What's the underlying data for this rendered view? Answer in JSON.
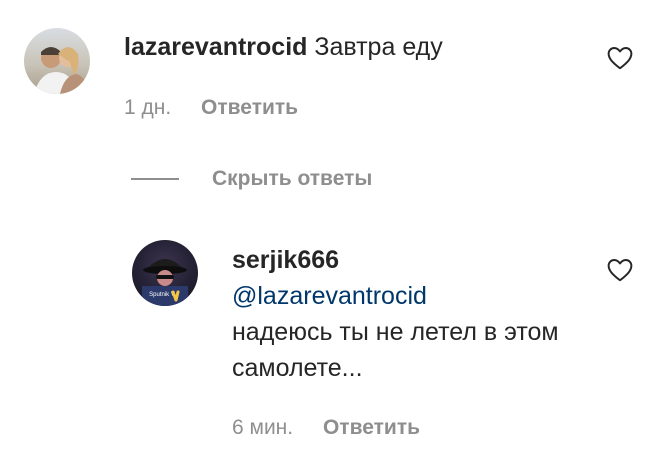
{
  "comment": {
    "username": "lazarevantrocid",
    "text": "Завтра еду",
    "time": "1 дн.",
    "reply_label": "Ответить"
  },
  "replies_toggle": {
    "label": "Скрыть ответы"
  },
  "reply": {
    "username": "serjik666",
    "mention": "@lazarevantrocid",
    "text": "надеюсь ты не летел в этом самолете...",
    "time": "6 мин.",
    "reply_label": "Ответить",
    "avatar_badge": "Sputnik V"
  },
  "colors": {
    "text": "#262626",
    "secondary": "#8e8e8e",
    "mention": "#00376b"
  }
}
